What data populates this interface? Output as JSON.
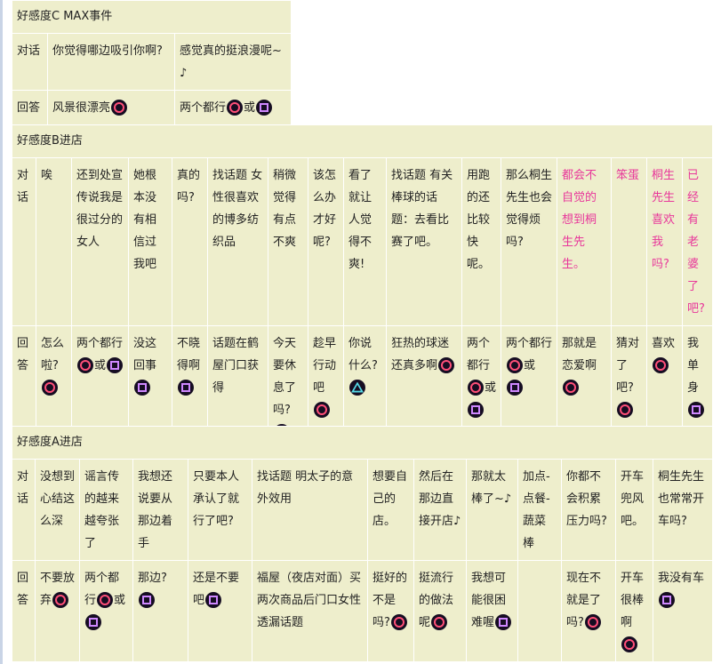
{
  "tables": [
    {
      "title": "好感度C MAX事件",
      "dialogue_label": "对话",
      "answer_label": "回答",
      "cols": [
        {
          "q": "你觉得哪边吸引你啊?",
          "a": [
            {
              "t": "风景很漂亮"
            },
            {
              "icon": "circle"
            }
          ]
        },
        {
          "q": "感觉真的挺浪漫呢~♪",
          "a": [
            {
              "t": "两个都行"
            },
            {
              "icon": "circle"
            },
            {
              "t": "或"
            },
            {
              "icon": "square"
            }
          ]
        }
      ]
    },
    {
      "title": "好感度B进店",
      "dialogue_label": "对话",
      "answer_label": "回答",
      "cols": [
        {
          "q": "唉",
          "a": [
            {
              "t": "怎么啦?"
            },
            {
              "icon": "circle"
            }
          ]
        },
        {
          "q": "还到处宣传说我是很过分的女人",
          "a": [
            {
              "t": "两个都行"
            },
            {
              "icon": "circle"
            },
            {
              "t": "或"
            },
            {
              "icon": "square"
            }
          ]
        },
        {
          "q": "她根本没有相信过我吧",
          "a": [
            {
              "t": "没这回事"
            },
            {
              "icon": "square"
            }
          ]
        },
        {
          "q": "真的吗?",
          "a": [
            {
              "t": "不晓得啊"
            },
            {
              "icon": "square"
            }
          ]
        },
        {
          "q": "找话题 女性很喜欢的博多纺织品",
          "a": [
            {
              "t": "话题在鹤屋门口获得"
            }
          ]
        },
        {
          "q": "稍微觉得有点不爽",
          "a": [
            {
              "t": "今天要休息了吗?"
            },
            {
              "icon": "square"
            }
          ]
        },
        {
          "q": "该怎么办才好呢?",
          "a": [
            {
              "t": "趁早行动吧"
            },
            {
              "icon": "circle"
            }
          ]
        },
        {
          "q": "看了就让人觉得不爽!",
          "a": [
            {
              "t": "你说什么?"
            },
            {
              "icon": "triangle"
            }
          ]
        },
        {
          "q": "找话题 有关棒球的话题：去看比赛了吧。",
          "a": [
            {
              "t": "狂热的球迷还真多啊"
            },
            {
              "icon": "circle"
            }
          ]
        },
        {
          "q": "用跑的还比较快呢。",
          "a": [
            {
              "t": "两个都行"
            },
            {
              "icon": "circle"
            },
            {
              "t": "或"
            },
            {
              "icon": "square"
            }
          ]
        },
        {
          "q": "那么桐生先生也会觉得烦吗?",
          "a": [
            {
              "t": "两个都行"
            },
            {
              "icon": "circle"
            },
            {
              "t": "或"
            },
            {
              "icon": "square"
            }
          ]
        },
        {
          "q": "都会不自觉的想到桐生先生。",
          "pink": true,
          "a": [
            {
              "t": "那就是恋爱啊"
            },
            {
              "icon": "circle"
            }
          ]
        },
        {
          "q": "笨蛋",
          "pink": true,
          "a": [
            {
              "t": "猜对了吧?"
            },
            {
              "icon": "circle"
            }
          ]
        },
        {
          "q": "桐生先生喜欢我吗?",
          "pink": true,
          "a": [
            {
              "t": "喜欢"
            },
            {
              "icon": "circle"
            }
          ]
        },
        {
          "q": "已经有老婆了吧?",
          "pink": true,
          "a": [
            {
              "t": "我单身"
            },
            {
              "icon": "square"
            }
          ]
        }
      ]
    },
    {
      "title": "好感度A进店",
      "dialogue_label": "对话",
      "answer_label": "回答",
      "cols": [
        {
          "q": "没想到心结这么深",
          "a": [
            {
              "t": "不要放弃"
            },
            {
              "icon": "circle"
            }
          ]
        },
        {
          "q": "谣言传的越来越夸张了",
          "a": [
            {
              "t": "两个都行"
            },
            {
              "icon": "circle"
            },
            {
              "t": "或"
            },
            {
              "icon": "square"
            }
          ]
        },
        {
          "q": "我想还说要从那边着手",
          "a": [
            {
              "t": "那边?"
            },
            {
              "icon": "square"
            }
          ]
        },
        {
          "q": "只要本人承认了就行了吧?",
          "a": [
            {
              "t": "还是不要吧"
            },
            {
              "icon": "square"
            }
          ]
        },
        {
          "q": "找话题 明太子的意外效用",
          "a": [
            {
              "t": "福屋（夜店对面）买两次商品后门口女性透漏话题"
            }
          ]
        },
        {
          "q": "想要自己的店。",
          "a": [
            {
              "t": "挺好的不是吗?"
            },
            {
              "icon": "circle"
            }
          ]
        },
        {
          "q": "然后在那边直接开店♪",
          "a": [
            {
              "t": "挺流行的做法呢"
            },
            {
              "icon": "circle"
            }
          ]
        },
        {
          "q": "那就太棒了~♪",
          "a": [
            {
              "t": "我想可能很困难喔"
            },
            {
              "icon": "square"
            }
          ]
        },
        {
          "q": "加点-点餐-蔬菜棒",
          "a": []
        },
        {
          "q": "你都不会积累压力吗?",
          "a": [
            {
              "t": "现在不就是了吗?"
            },
            {
              "icon": "circle"
            }
          ]
        },
        {
          "q": "开车兜风吧。",
          "a": [
            {
              "t": "开车很棒啊"
            },
            {
              "icon": "circle"
            }
          ]
        },
        {
          "q": "桐生先生也常常开车吗?",
          "a": [
            {
              "t": "我没有车"
            },
            {
              "icon": "square"
            }
          ]
        }
      ]
    }
  ]
}
